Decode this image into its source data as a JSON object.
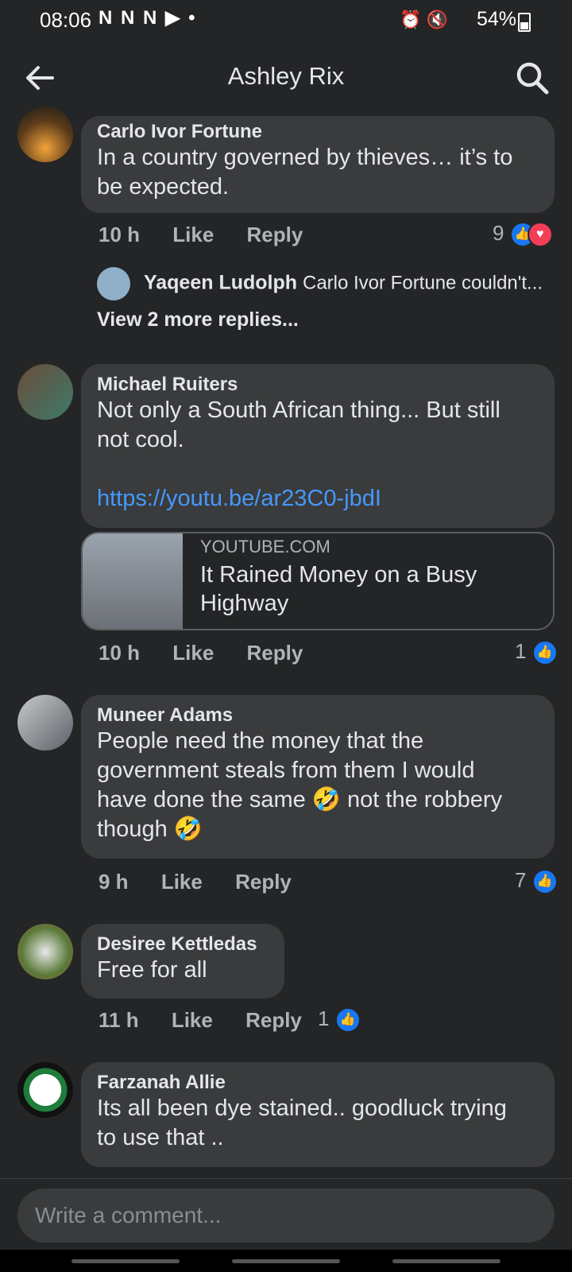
{
  "status": {
    "time": "08:06",
    "left_icons": "N N N",
    "battery": "54%"
  },
  "header": {
    "title": "Ashley Rix"
  },
  "comments": [
    {
      "author": "Carlo Ivor Fortune",
      "text1": "In a country governed by thieves… it’s to",
      "text2": "be expected.",
      "time": "10 h",
      "like": "Like",
      "reply": "Reply",
      "reactions": "9"
    },
    {
      "author": "Michael Ruiters",
      "text1": "Not only a South African thing... But still",
      "text2": "not cool.",
      "link": "https://youtu.be/ar23C0-jbdI",
      "time": "10 h",
      "like": "Like",
      "reply": "Reply",
      "reactions": "1"
    },
    {
      "author": "Muneer Adams",
      "text1": "People need the money that the",
      "text2": "government steals from them I would",
      "text3": "have done the same 🤣 not the robbery",
      "text4": "though 🤣",
      "time": "9 h",
      "like": "Like",
      "reply": "Reply",
      "reactions": "7"
    },
    {
      "author": "Desiree Kettledas",
      "text1": "Free for all",
      "time": "11 h",
      "like": "Like",
      "reply": "Reply",
      "reactions": "1"
    },
    {
      "author": "Farzanah Allie",
      "text1": "Its all been dye stained..  goodluck trying",
      "text2": "to use that .."
    }
  ],
  "reply_preview": {
    "name": "Yaqeen Ludolph",
    "text": "Carlo Ivor Fortune couldn't...",
    "view_more": "View 2 more replies..."
  },
  "link_card": {
    "domain": "YOUTUBE.COM",
    "title": "It Rained Money on a Busy Highway"
  },
  "composer": {
    "placeholder": "Write a comment..."
  },
  "colors": {
    "background": "#242526",
    "bubble": "#3a3b3c",
    "link": "#4599ff",
    "like": "#1877f2",
    "love": "#f33e58"
  }
}
